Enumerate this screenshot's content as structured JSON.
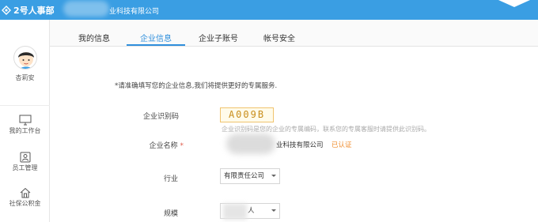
{
  "header": {
    "brand": "2号人事部",
    "company_suffix": "业科技有限公司"
  },
  "sidebar": {
    "username": "杏莉安",
    "items": [
      {
        "label": "我的工作台",
        "icon": "monitor-icon"
      },
      {
        "label": "员工管理",
        "icon": "employee-icon"
      },
      {
        "label": "社保公积金",
        "icon": "house-icon"
      }
    ]
  },
  "tabs": [
    {
      "label": "我的信息",
      "active": false
    },
    {
      "label": "企业信息",
      "active": true
    },
    {
      "label": "企业子账号",
      "active": false
    },
    {
      "label": "帐号安全",
      "active": false
    }
  ],
  "form": {
    "notice": "*请准确填写您的企业信息,我们将提供更好的专属服务.",
    "id_label": "企业识别码",
    "id_code": "A009B",
    "id_hint": "企业识别码是您的企业的专属编码，联系您的专属客服时请提供此识别码。",
    "name_label": "企业名称",
    "name_required": "*",
    "name_value": "业科技有限公司",
    "verified": "已认证",
    "industry_label": "行业",
    "industry_value": "有限责任公司",
    "scale_label": "规模",
    "scale_value": "人"
  },
  "colors": {
    "topbar": "#3a9ee3",
    "accent": "#2f8fdc",
    "verified": "#f08c2d"
  }
}
